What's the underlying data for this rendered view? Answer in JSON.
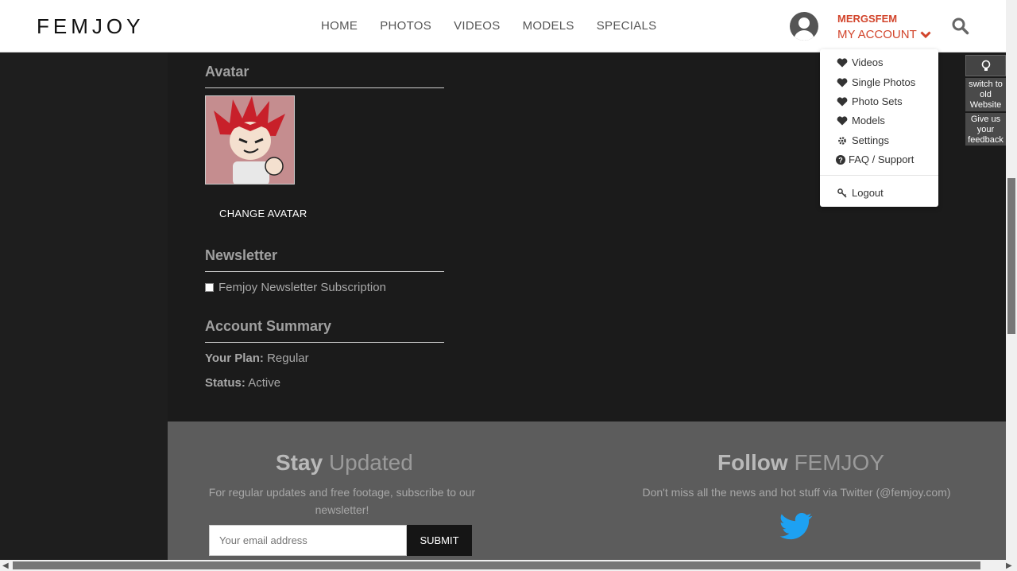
{
  "header": {
    "logo": "FEMJOY",
    "nav": [
      "HOME",
      "PHOTOS",
      "VIDEOS",
      "MODELS",
      "SPECIALS"
    ],
    "username": "MERGSFEM",
    "my_account": "MY ACCOUNT"
  },
  "dropdown": {
    "items": [
      {
        "label": "Videos",
        "icon": "heart-icon"
      },
      {
        "label": "Single Photos",
        "icon": "heart-icon"
      },
      {
        "label": "Photo Sets",
        "icon": "heart-icon"
      },
      {
        "label": "Models",
        "icon": "heart-icon"
      },
      {
        "label": "Settings",
        "icon": "gear-icon"
      },
      {
        "label": "FAQ / Support",
        "icon": "question-icon"
      }
    ],
    "logout": "Logout"
  },
  "tools": {
    "switch": "switch to old Website",
    "feedback": "Give us your feedback"
  },
  "avatar": {
    "title": "Avatar",
    "change": "CHANGE AVATAR"
  },
  "newsletter": {
    "title": "Newsletter",
    "checkbox": "Femjoy Newsletter Subscription"
  },
  "summary": {
    "title": "Account Summary",
    "plan_label": "Your Plan:",
    "plan_value": "Regular",
    "status_label": "Status:",
    "status_value": "Active"
  },
  "footer": {
    "stay_a": "Stay",
    "stay_b": "Updated",
    "stay_text_1": "For regular updates and free footage, subscribe to our",
    "stay_text_2": "newsletter!",
    "email_placeholder": "Your email address",
    "submit": "SUBMIT",
    "follow_a": "Follow",
    "follow_b": "FEMJOY",
    "follow_text": "Don't miss all the news and hot stuff via Twitter (@femjoy.com)"
  },
  "colors": {
    "accent": "#d2442b",
    "twitter": "#1da1f2"
  }
}
